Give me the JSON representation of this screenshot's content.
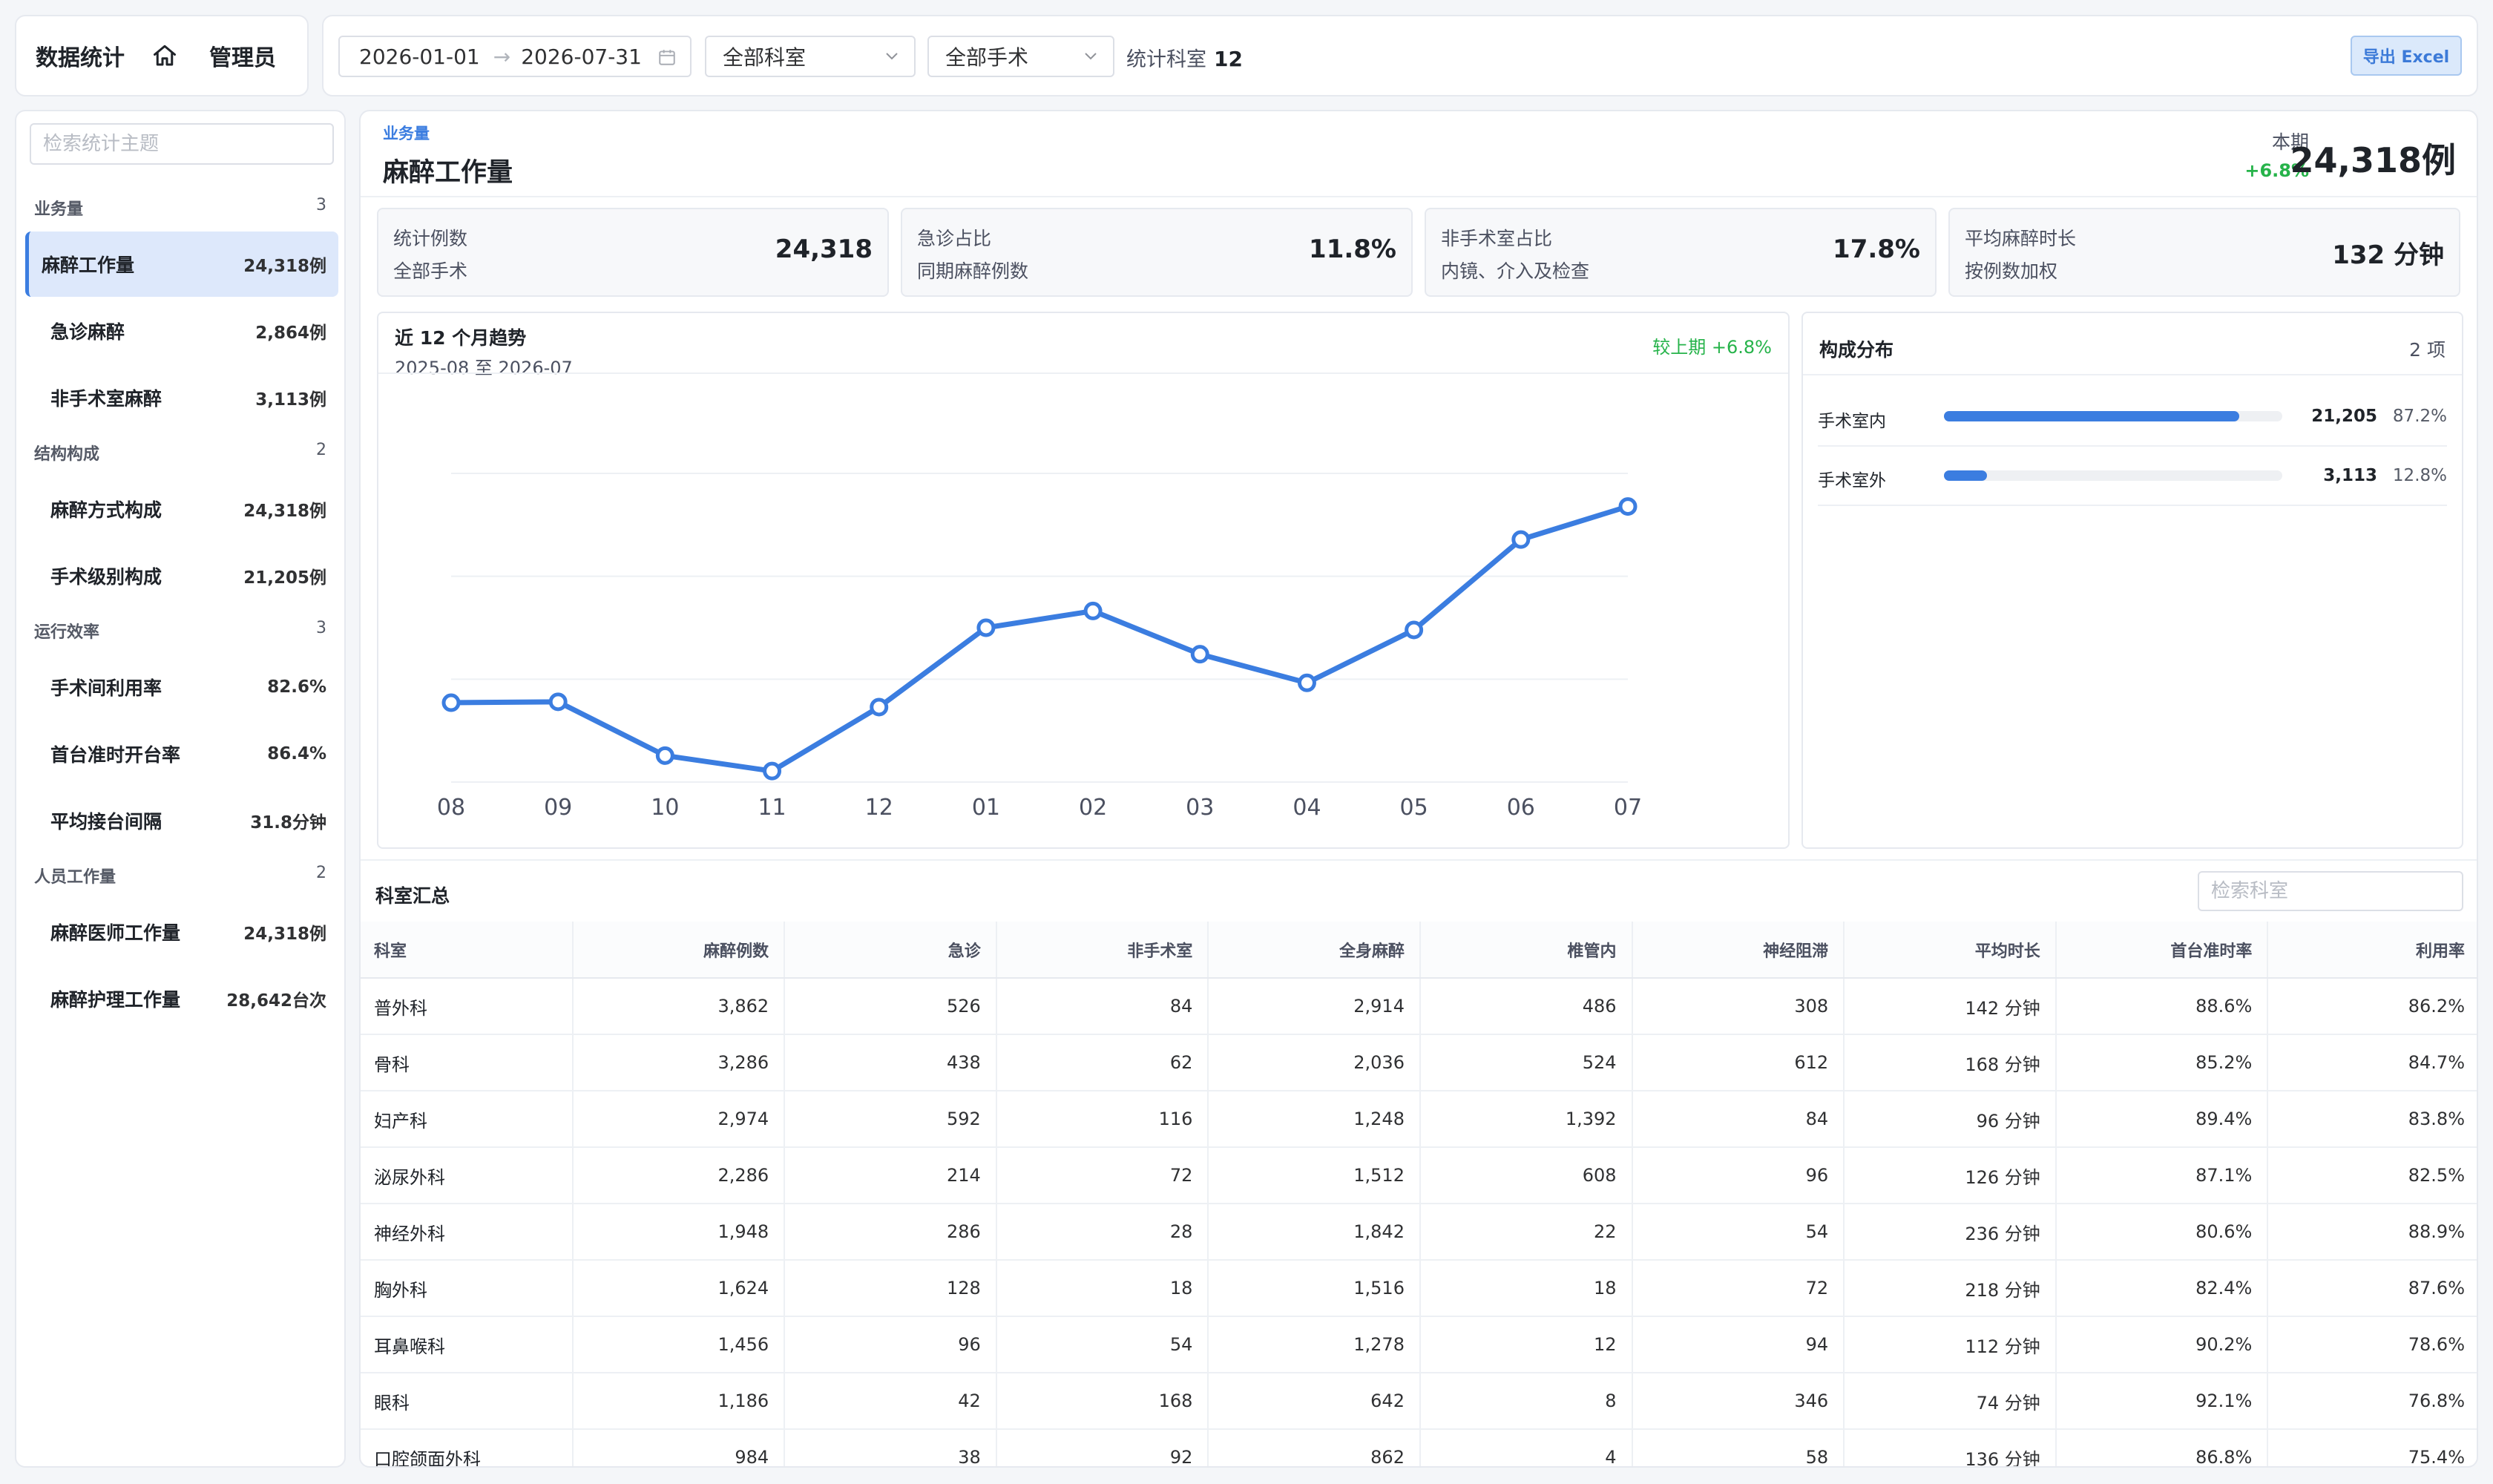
{
  "brand": {
    "title": "数据统计",
    "user": "管理员"
  },
  "filters": {
    "date_start": "2026-01-01",
    "date_end": "2026-07-31",
    "department": "全部科室",
    "surgery": "全部手术",
    "dept_count_label": "统计科室",
    "dept_count": "12",
    "export_label": "导出 Excel"
  },
  "sidebar": {
    "search_placeholder": "检索统计主题",
    "groups": [
      {
        "label": "业务量",
        "count": "3",
        "items": [
          {
            "label": "麻醉工作量",
            "value": "24,318例",
            "active": true
          },
          {
            "label": "急诊麻醉",
            "value": "2,864例"
          },
          {
            "label": "非手术室麻醉",
            "value": "3,113例"
          }
        ]
      },
      {
        "label": "结构构成",
        "count": "2",
        "items": [
          {
            "label": "麻醉方式构成",
            "value": "24,318例"
          },
          {
            "label": "手术级别构成",
            "value": "21,205例"
          }
        ]
      },
      {
        "label": "运行效率",
        "count": "3",
        "items": [
          {
            "label": "手术间利用率",
            "value": "82.6%"
          },
          {
            "label": "首台准时开台率",
            "value": "86.4%"
          },
          {
            "label": "平均接台间隔",
            "value": "31.8分钟"
          }
        ]
      },
      {
        "label": "人员工作量",
        "count": "2",
        "items": [
          {
            "label": "麻醉医师工作量",
            "value": "24,318例"
          },
          {
            "label": "麻醉护理工作量",
            "value": "28,642台次"
          }
        ]
      }
    ]
  },
  "header": {
    "tag": "业务量",
    "title": "麻醉工作量",
    "period_label": "本期",
    "period_change": "+6.8%",
    "period_value": "24,318例"
  },
  "kpis": [
    {
      "label": "统计例数",
      "sub": "全部手术",
      "value": "24,318"
    },
    {
      "label": "急诊占比",
      "sub": "同期麻醉例数",
      "value": "11.8%"
    },
    {
      "label": "非手术室占比",
      "sub": "内镜、介入及检查",
      "value": "17.8%"
    },
    {
      "label": "平均麻醉时长",
      "sub": "按例数加权",
      "value": "132 分钟"
    }
  ],
  "trend": {
    "title": "近 12 个月趋势",
    "subtitle": "2025-08 至 2026-07",
    "change": "较上期 +6.8%"
  },
  "chart_data": {
    "type": "line",
    "categories": [
      "08",
      "09",
      "10",
      "11",
      "12",
      "01",
      "02",
      "03",
      "04",
      "05",
      "06",
      "07"
    ],
    "values": [
      1880,
      1882,
      1760,
      1725,
      1870,
      2050,
      2088,
      1990,
      1925,
      2045,
      2250,
      2325
    ],
    "ylim": [
      1700,
      2400
    ],
    "grid": true,
    "color": "#3b7de0"
  },
  "composition": {
    "title": "构成分布",
    "count": "2 项",
    "rows": [
      {
        "name": "手术室内",
        "value": "21,205",
        "pct": "87.2%",
        "ratio": 0.872
      },
      {
        "name": "手术室外",
        "value": "3,113",
        "pct": "12.8%",
        "ratio": 0.128
      }
    ]
  },
  "table": {
    "title": "科室汇总",
    "search_placeholder": "检索科室",
    "columns": [
      "科室",
      "麻醉例数",
      "急诊",
      "非手术室",
      "全身麻醉",
      "椎管内",
      "神经阻滞",
      "平均时长",
      "首台准时率",
      "利用率"
    ],
    "rows": [
      [
        "普外科",
        "3,862",
        "526",
        "84",
        "2,914",
        "486",
        "308",
        "142 分钟",
        "88.6%",
        "86.2%"
      ],
      [
        "骨科",
        "3,286",
        "438",
        "62",
        "2,036",
        "524",
        "612",
        "168 分钟",
        "85.2%",
        "84.7%"
      ],
      [
        "妇产科",
        "2,974",
        "592",
        "116",
        "1,248",
        "1,392",
        "84",
        "96 分钟",
        "89.4%",
        "83.8%"
      ],
      [
        "泌尿外科",
        "2,286",
        "214",
        "72",
        "1,512",
        "608",
        "96",
        "126 分钟",
        "87.1%",
        "82.5%"
      ],
      [
        "神经外科",
        "1,948",
        "286",
        "28",
        "1,842",
        "22",
        "54",
        "236 分钟",
        "80.6%",
        "88.9%"
      ],
      [
        "胸外科",
        "1,624",
        "128",
        "18",
        "1,516",
        "18",
        "72",
        "218 分钟",
        "82.4%",
        "87.6%"
      ],
      [
        "耳鼻喉科",
        "1,456",
        "96",
        "54",
        "1,278",
        "12",
        "94",
        "112 分钟",
        "90.2%",
        "78.6%"
      ],
      [
        "眼科",
        "1,186",
        "42",
        "168",
        "642",
        "8",
        "346",
        "74 分钟",
        "92.1%",
        "76.8%"
      ],
      [
        "口腔颌面外科",
        "984",
        "38",
        "92",
        "862",
        "4",
        "58",
        "136 分钟",
        "86.8%",
        "75.4%"
      ]
    ]
  }
}
